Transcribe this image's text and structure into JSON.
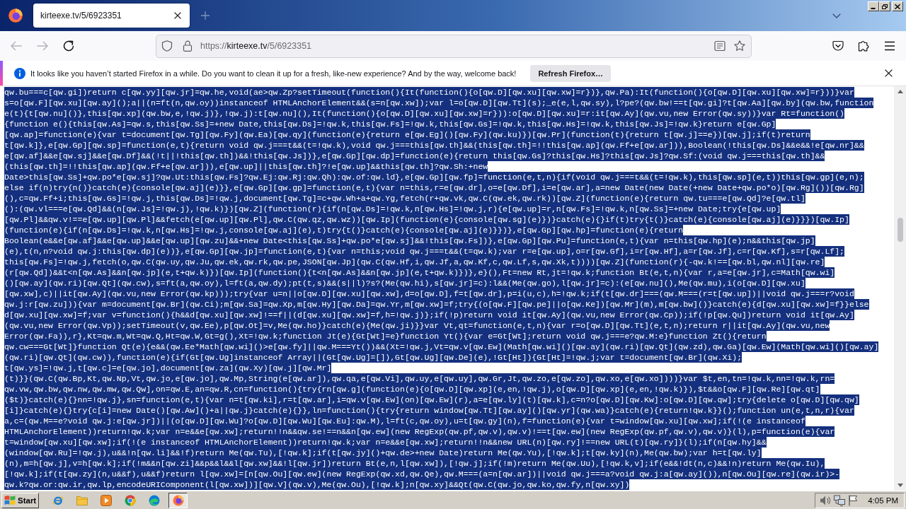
{
  "browser": {
    "tabs": [
      {
        "title": "kirteexe.tv/5/6923351",
        "selected": true
      }
    ],
    "nav_buttons": [
      {
        "disabled": true
      },
      {
        "disabled": true
      },
      {
        "disabled": false
      }
    ],
    "address": {
      "scheme": "https://",
      "host": "kirteexe.tv",
      "path": "/5/6923351"
    }
  },
  "notification": {
    "message": "It looks like you haven’t started Firefox in a while. Do you want to clean it up for a fresh, like-new experience? And by the way, welcome back!",
    "button": "Refresh Firefox…"
  },
  "code": {
    "selected": true,
    "lines": [
      "qw.bu===c[qw.gi])return c[qw.yy][qw.jr]=qw.he,void(ae>qw.Zp?setTimeout(function(){It(function(){o[qw.D][qw.xu][qw.xw]=r})},qw.Pa):It(function(){o[qw.D][qw.xu][qw.xw]=r}))}var",
      "s=o[qw.F][qw.xu][qw.ay]();a||(n=ft(n,qw.oy))instanceof HTMLAnchorElement&&(s=n[qw.xw]);var l=o[qw.D][qw.Tt](s);_e(e,l,qw.sy),l?pe?(qw.bw!==t[qw.gi]?t[qw.Aa][qw.by](qw.bw,function",
      "e(t){t[qw.nu]()},this[qw.xp](qw.bw,e,!qw.j)},!qw.j):t[qw.nu](),It(function(){o[qw.D][qw.xu][qw.xw]=r})):o[qw.D][qw.xu]=r:it[qw.Ay](qw.vu,new Error(qw.sy))}var Rt=function()",
      "{function e(){this[qw.As]=qw.s,this[qw.Ss]=+new Date,this[qw.Ds]=!qw.k,this[qw.Fs]=!qw.k,this[qw.Gs]=!qw.k,this[qw.Hs]=!qw.k,this[qw.Js]=!qw.k}return e[qw.Gp]",
      "[qw.ap]=function(e){var t=document[qw.Tg][qw.Fy](qw.Ea)[qw.qy](function(e){return e[qw.Eg]()[qw.Fy](qw.ku)})[qw.Pr](function(t){return t[qw.j]==e})[qw.j];if(t)return",
      "t[qw.k]},e[qw.Gp][qw.sp]=function(e,t){return void qw.j===t&&(t=!qw.k),void qw.j===this[qw.th]&&(this[qw.th]=!!this[qw.ap](qw.Ff+e[qw.ar])),Boolean(!this[qw.Ds]&&e&&!e[qw.nr]&&",
      "e[qw.af]&&e[qw.sj]&&e[qw.Df]&&(!t||!this[qw.th])&&!this[qw.Js])},e[qw.Gp][qw.dp]=function(e){return this[qw.Gs]?this[qw.Hs]?this[qw.Js]?qw.Sf:(void qw.j===this[qw.th]&&",
      "(this[qw.th]=!!this[qw.ap](qw.Ff+e[qw.ar])),e[qw.up]||this[qw.th]?!e[qw.up]&&this[qw.th]?qw.Sh:+new",
      "Date>this[qw.Ss]+qw.po*e[qw.sj]?qw.Ut:this[qw.Fs]?qw.Ej:qw.Rj:qw.Qh):qw.of:qw.ld},e[qw.Gp][qw.fp]=function(e,t,n){if(void qw.j===t&&(t=!qw.k),this[qw.sp](e,t))this[qw.gp](e,n);",
      "else if(n)try{n()}catch(e){console[qw.aj](e)}},e[qw.Gp][qw.gp]=function(e,t){var n=this,r=e[qw.dr],o=e[qw.Df],i=e[qw.ar],a=new Date(new Date(+new Date+qw.po*o)[qw.Rg]())[qw.Rg]",
      "(),c=qw.Ff+i;this[qw.Gs]=!qw.j,this[qw.Ds]=!qw.j,document[qw.Tg]=c+qw.Wh+a+qw.Yg,fetch(r+qw.vk,qw.C(qw.ek,qw.rk))[qw.Z](function(e){return qw.tu===e[qw.Qd]?e[qw.tl]",
      "():(qw.vl===e[qw.Qd]&&(n[qw.Js]=!qw.j),!qw.k)})[qw.Z](function(r){if(n[qw.Ds]=!qw.k,n[qw.Hs]=!qw.j,r){e[qw.up]=r,n[qw.Fs]=!qw.k,n[qw.Ss]=+new Date;try{e[qw.up]",
      "[qw.Pl]&&qw.v!==e[qw.up][qw.Pl]&&fetch(e[qw.up][qw.Pl],qw.C(qw.qz,qw.wz))[qw.Ip](function(e){console[qw.sg](e)})}catch(e){}if(t)try{t()}catch(e){console[qw.aj](e)}}})[qw.Ip]",
      "(function(e){if(n[qw.Ds]=!qw.k,n[qw.Hs]=!qw.j,console[qw.aj](e),t)try{t()}catch(e){console[qw.aj](e)}})},e[qw.Gp][qw.hp]=function(e){return",
      "Boolean(e&&e[qw.af]&&e[qw.up]&&e[qw.up][qw.zu]&&+new Date<this[qw.Ss]+qw.po*e[qw.sj]&&!this[qw.Fs])},e[qw.Gp][qw.Pu]=function(e,t){var n=this[qw.hp](e);n&&this[qw.jp]",
      "(e),t(n,n?void qw.j:this[qw.dp](e))},e[qw.Gp][qw.jp]=function(e,t){var n=this;void qw.j===t&&(t=qw.k);var r=e[qw.up],o=r[qw.Gf],i=r[qw.Hf],a=r[qw.Jf],c=r[qw.Kf],s=r[qw.Lf];",
      "this[qw.Fs]=!qw.j,fetch(o,qw.C(qw.uy,qw.Ju,qw.ek,qw.rk,qw.pe,JSON[qw.Jp](qw.C(qw.Hf,i,qw.Jf,a,qw.Kf,c,qw.Lf,s,qw.Xk,t))))[qw.Z](function(r){-qw.k!==[qw.bl,qw.nl][qw.re]",
      "(r[qw.Qd])&&t<n[qw.As]&&n[qw.jp](e,t+qw.k)})[qw.Ip](function(){t<n[qw.As]&&n[qw.jp](e,t+qw.k)})},e}(),Ft=new Rt,jt=!qw.k;function Bt(e,t,n){var r,a=e[qw.jr],c=Math[qw.wi]",
      "()[qw.ay](qw.ri)[qw.Qt](qw.cw),s=ft(a,qw.oy),l=ft(a,qw.dy);pt(t,s)&&(s||l)?s?(Me(qw.hi),s[qw.jr]=c):l&&(Me(qw.go),l[qw.jr]=c):(e[qw.nu](),Me(qw.mu),i(o[qw.D][qw.xu]",
      "[qw.xw],c)||it[qw.Ay](qw.vu,new Error(qw.kp)));try{var u=n||o[qw.D][qw.xu][qw.xw],d=o[qw.D],f=t[qw.dr],p=i(u,c),h=!qw.k;if(t[qw.dr]===(qw.M===(r=t[qw.up])||void qw.j===r?void",
      "qw.j:r[qw.zu])){var m=document[qw.Br](qw.Ci);m[qw.Sa]=qw.Xp,m[qw.Hy][qw.Da]=qw.Yr,m[qw.xw]=f;try{(o[qw.F][qw.pe]||o[qw.Ke])[qw.Mr](m),m[qw.bw]()}catch(e){d[qw.xu][qw.xw]=f}}else",
      "d[qw.xu][qw.xw]=f;var v=function(){h&&d[qw.xu][qw.xw]!==f||(d[qw.xu][qw.xw]=f,h=!qw.j)};if(!p)return void it[qw.Ay](qw.vu,new Error(qw.Cp));if(!p[qw.Qu])return void it[qw.Ay]",
      "(qw.vu,new Error(qw.Vp));setTimeout(v,qw.Ee),p[qw.Ot]=v,Me(qw.ho)}catch(e){Me(qw.ji)}}var Vt,qt=function(e,t,n){var r=o[qw.D][qw.Tt](e,t,n);return r||it[qw.Ay](qw.vu,new",
      "Error(qw.Fa)),r},Kt=qw.m,Wt=qw.Q,Ht=qw.W,Gt=g(),Xt=!qw.k;function Jt(e){Gt[Wt]=e}function Yt(){var e=Gt[Wt];return void qw.j===e?qw.M:e}function Zt(){return",
      "qw.cw===Gt[Wt]}function Qt(e){e&&(qw.Ee*Math[qw.wi]()>e[qw.fy]||qw.M===Yt())&&(Xt=!qw.j,Vt=qw.v[qw.Ew](Math[qw.wi]()[qw.ay](qw.ri)[qw.Qt](qw.zd),qw.Ga)[qw.Ew](Math[qw.wi]()[qw.ay]",
      "(qw.ri)[qw.Qt](qw.cw)),function(e){if(Gt[qw.Ug]instanceof Array||(Gt[qw.Ug]=[]),Gt[qw.Ug][qw.De](e),!Gt[Ht]){Gt[Ht]=!qw.j;var t=document[qw.Br](qw.Xi);",
      "t[qw.ys]=!qw.j,t[qw.c]=e[qw.jo],document[qw.za](qw.Xy)[qw.j][qw.Mr]",
      "(t)}}(qw.C(qw.Bp,Kt,qw.Np,Vt,qw.jo,e[qw.jo],qw.Mp,String(e[qw.ar]),qw.qa,e[qw.Vi],qw.uy,e[qw.uy],qw.Gr,Jt,qw.zo,e[qw.zo],qw.xo,e[qw.xo])))}var $t,en,tn=!qw.k,nn=!qw.k,rn=",
      "qw.vw,qw.bw,qw.nw,qw.mw,qw.Qw],on=qw.E,an=qw.R,cn=function(){try{rn[qw.g](function(e){o[qw.D][qw.xp](e,en,!qw.j),o[qw.D][qw.xp](e,en,!qw.k)}),$t&&o[qw.F][qw.Re][qw.qt]",
      "($t)}catch(e){}nn=!qw.j},sn=function(e,t){var n=t[qw.ki],r=t[qw.ar],i=qw.v[qw.Ew](on)[qw.Ew](r),a=e[qw.ly](t)[qw.k],c=n?o[qw.D][qw.Kw]:o[qw.D][qw.qw];try{delete o[qw.D][qw.qw]",
      "[i]}catch(e){}try{c[i]=new Date()[qw.Aw]()+a||qw.j}catch(e){}},ln=function(){try{return window[qw.Tt][qw.ay]()[qw.yr](qw.wa)}catch(e){return!qw.k}}();function un(e,t,n,r){var",
      "a,c=(qw.M==e?void qw.j:e[qw.jr])||(o[qw.D][qw.Wu]?o[qw.D][qw.Wu][qw.Eu]:qw.M),l=ft(c,qw.oy),u=t[qw.gy](n),f=function(e){var t=window[qw.xu][qw.xw];if(!(e instanceof",
      "HTMLAnchorElement))return!qw.k;var n=e&&e[qw.xw];return!!n&&qw.se!==n&&n[qw.ew](new RegExp(qw.pf,qw.v),qw.v)!==t[qw.ew](new RegExp(qw.pf,qw.v),qw.v)}(l),p=function(e){var",
      "t=window[qw.xu][qw.xw];if(!(e instanceof HTMLAnchorElement))return!qw.k;var n=e&&e[qw.xw];return!!n&&new URL(n)[qw.ry]!==new URL(t)[qw.ry]}(l);if(n[qw.hy]&&",
      "(window[qw.Ru]=!qw.j),u&&!n[qw.li]&&!f)return Me(qw.Tu),[!qw.k];if(t[qw.jy]()+qw.de>+new Date)return Me(qw.Yu),[!qw.k];t[qw.ky](n),Me(qw.bw);var h=t[qw.ly]",
      "(n),m=h[qw.j],v=h[qw.k];if(!m&&n[qw.zi]&&p&&l&&l[qw.xw]&&!l[qw.jr])return Bt(e,n,l[qw.xw]),[!qw.j];if(!m)return Me(qw.Uu),[!qw.k,v];if(e&&!dt(n,c)&&!n)return Me(qw.Iu),",
      "[!qw.k];if(t[qw.zy](n,u&&f),u&&f)return l[qw.xw]=[n[qw.Ou][qw.ew](new RegExp(qw.xd,qw.Qe),qw.M===(a=n[qw.ar])||void qw.j===a?void qw.j:a[qw.ay]()),n[qw.Ou][qw.re](qw.ir)>-",
      "qw.k?qw.or:qw.ir,qw.lp,encodeURIComponent(l[qw.xw])][qw.V](qw.v),Me(qw.Ou),[!qw.k];n[qw.xy]&&Qt(qw.C(qw.jo,qw.ko,qw.fy,n[qw.xy])"
    ]
  },
  "taskbar": {
    "start": "Start",
    "quick_launch": [
      {
        "selected": false
      },
      {
        "selected": false
      },
      {
        "selected": false
      },
      {
        "selected": false
      },
      {
        "selected": false
      },
      {
        "selected": true
      }
    ],
    "clock": "4:05 PM"
  }
}
